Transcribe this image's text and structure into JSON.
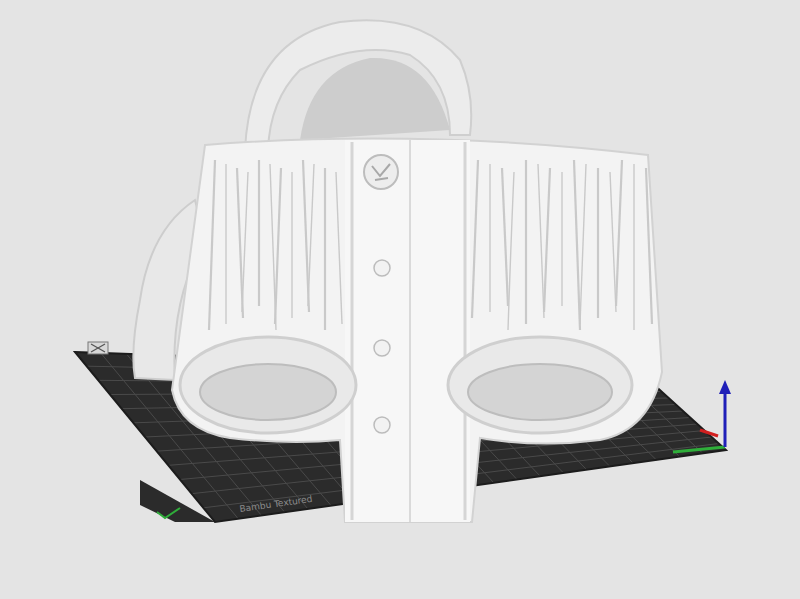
{
  "viewport": {
    "plate_label": "Bambu Textured"
  },
  "axes": [
    {
      "axis": "z",
      "color": "#1f1fb8"
    },
    {
      "axis": "x",
      "color": "#d11f1f"
    },
    {
      "axis": "y",
      "color": "#2fae3a"
    }
  ]
}
